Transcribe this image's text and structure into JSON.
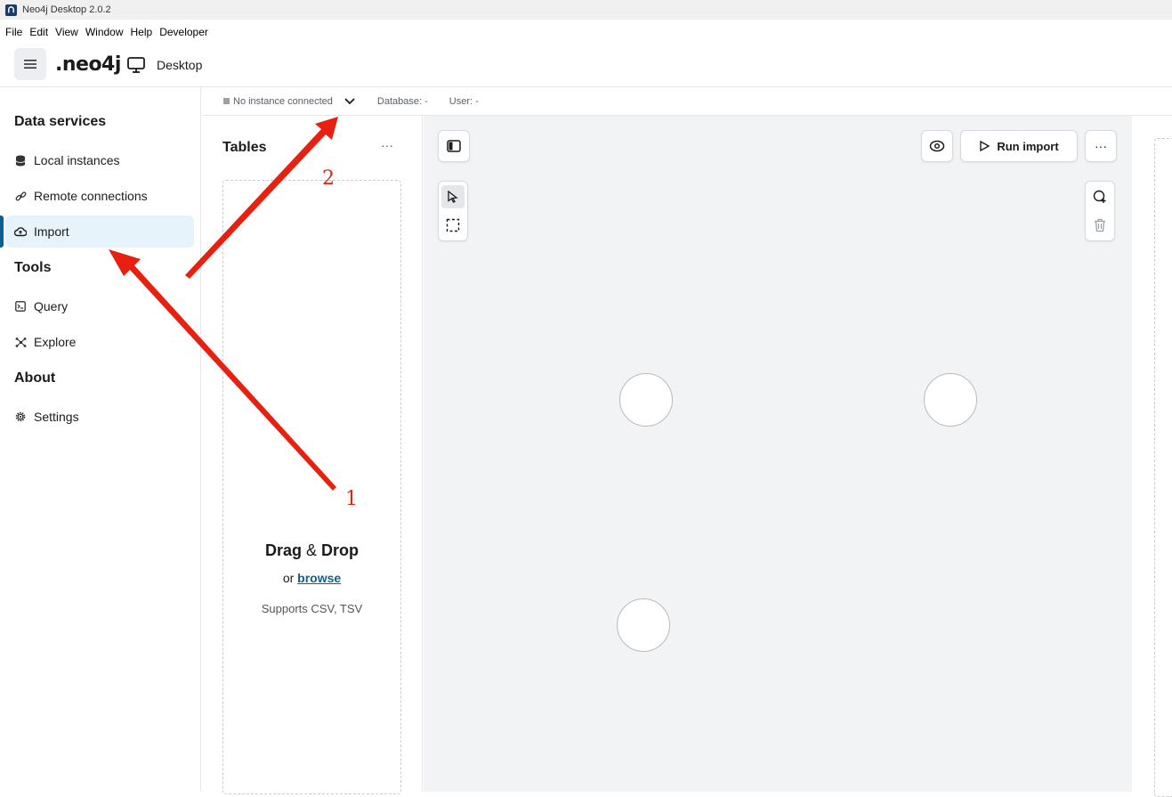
{
  "window": {
    "title": "Neo4j Desktop 2.0.2"
  },
  "menu": [
    "File",
    "Edit",
    "View",
    "Window",
    "Help",
    "Developer"
  ],
  "header": {
    "logo": ".neo4j",
    "app_label": "Desktop"
  },
  "sidebar": {
    "sections": [
      {
        "heading": "Data services",
        "items": [
          {
            "label": "Local instances",
            "icon": "database-icon"
          },
          {
            "label": "Remote connections",
            "icon": "link-icon"
          },
          {
            "label": "Import",
            "icon": "cloud-upload-icon",
            "active": true
          }
        ]
      },
      {
        "heading": "Tools",
        "items": [
          {
            "label": "Query",
            "icon": "terminal-icon"
          },
          {
            "label": "Explore",
            "icon": "explore-icon"
          }
        ]
      },
      {
        "heading": "About",
        "items": [
          {
            "label": "Settings",
            "icon": "gear-icon"
          }
        ]
      }
    ]
  },
  "instance_bar": {
    "status": "No instance connected",
    "database": "Database: -",
    "user": "User: -"
  },
  "tables": {
    "title": "Tables",
    "more": "···",
    "drop_title_a": "Drag",
    "drop_title_amp": "&",
    "drop_title_b": "Drop",
    "drop_or": "or",
    "drop_browse": "browse",
    "drop_support": "Supports CSV, TSV"
  },
  "canvas": {
    "run_import": "Run import",
    "more": "···"
  },
  "annotations": {
    "label1": "1",
    "label2": "2",
    "color": "#e8200f"
  }
}
